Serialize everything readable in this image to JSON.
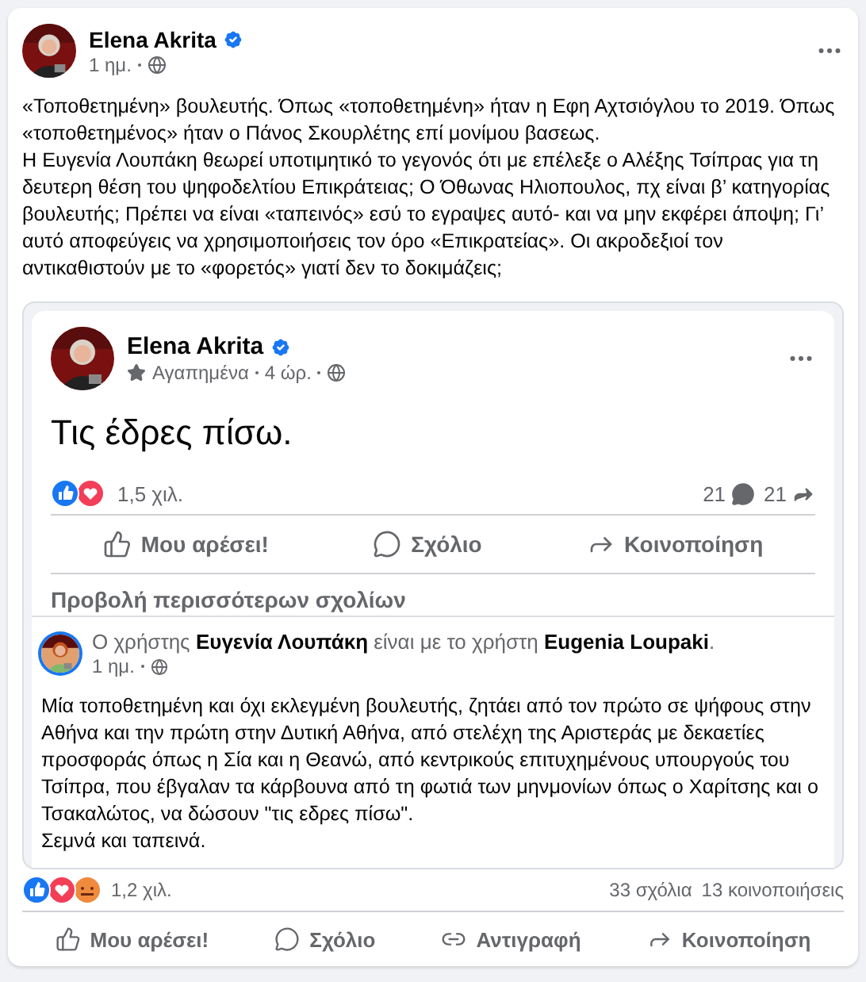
{
  "post": {
    "author": "Elena Akrita",
    "time": "1 ημ.",
    "paragraphs": [
      "«Τοποθετημένη» βουλευτής. Όπως «τοποθετημένη» ήταν η Εφη Αχτσιόγλου το 2019. Όπως «τοποθετημένος» ήταν ο Πάνος Σκουρλέτης επί μονίμου βασεως.",
      "Η Ευγενία Λουπάκη θεωρεί υποτιμητικό το γεγονός ότι με επέλεξε ο Αλέξης Τσίπρας για τη δευτερη θέση του ψηφοδελτίου Επικράτειας; Ο Όθωνας Ηλιοπουλος, πχ είναι β’ κατηγορίας βουλευτής; Πρέπει να είναι «ταπεινός» εσύ το εγραψες αυτό- και να μην εκφέρει άποψη; Γι’ αυτό αποφεύγεις να χρησιμοποιήσεις τον όρο «Επικρατείας». Οι ακροδεξιοί τον αντικαθιστούν με το «φορετός» γιατί δεν το δοκιμάζεις;"
    ],
    "reactions_count": "1,2 χιλ.",
    "comments_count": "33 σχόλια",
    "shares_count": "13 κοινοποιήσεις",
    "actions": [
      {
        "kind": "like",
        "label": "Μου αρέσει!"
      },
      {
        "kind": "comment",
        "label": "Σχόλιο"
      },
      {
        "kind": "copy",
        "label": "Αντιγραφή"
      },
      {
        "kind": "share",
        "label": "Κοινοποίηση"
      }
    ]
  },
  "shared_post": {
    "author": "Elena Akrita",
    "audience": "Αγαπημένα",
    "time": "4 ώρ.",
    "text": "Τις έδρες πίσω.",
    "reactions_count": "1,5 χιλ.",
    "comments_count": "21",
    "shares_count": "21",
    "actions": [
      {
        "kind": "like",
        "label": "Μου αρέσει!"
      },
      {
        "kind": "comment",
        "label": "Σχόλιο"
      },
      {
        "kind": "share",
        "label": "Κοινοποίηση"
      }
    ],
    "more_comments": "Προβολή περισσότερων σχολίων",
    "comment": {
      "header": "Ο χρήστης **Ευγενία Λουπάκη** είναι με το χρήστη **Eugenia Loupaki**.",
      "time": "1 ημ.",
      "paragraphs": [
        "Μία τοποθετημένη και όχι εκλεγμένη βουλευτής, ζητάει από τον πρώτο σε ψήφους στην Αθήνα και την πρώτη στην Δυτική Αθήνα, από στελέχη της Αριστεράς με δεκαετίες προσφοράς όπως η Σία και η Θεανώ, από κεντρικούς επιτυχημένους υπουργούς του Τσίπρα, που έβγαλαν τα κάρβουνα από τη φωτιά των μηνμονίων όπως ο Χαρίτσης και ο Τσακαλώτος, να δώσουν \"τις εδρες πίσω\".",
        "Σεμνά και ταπεινά."
      ]
    }
  }
}
